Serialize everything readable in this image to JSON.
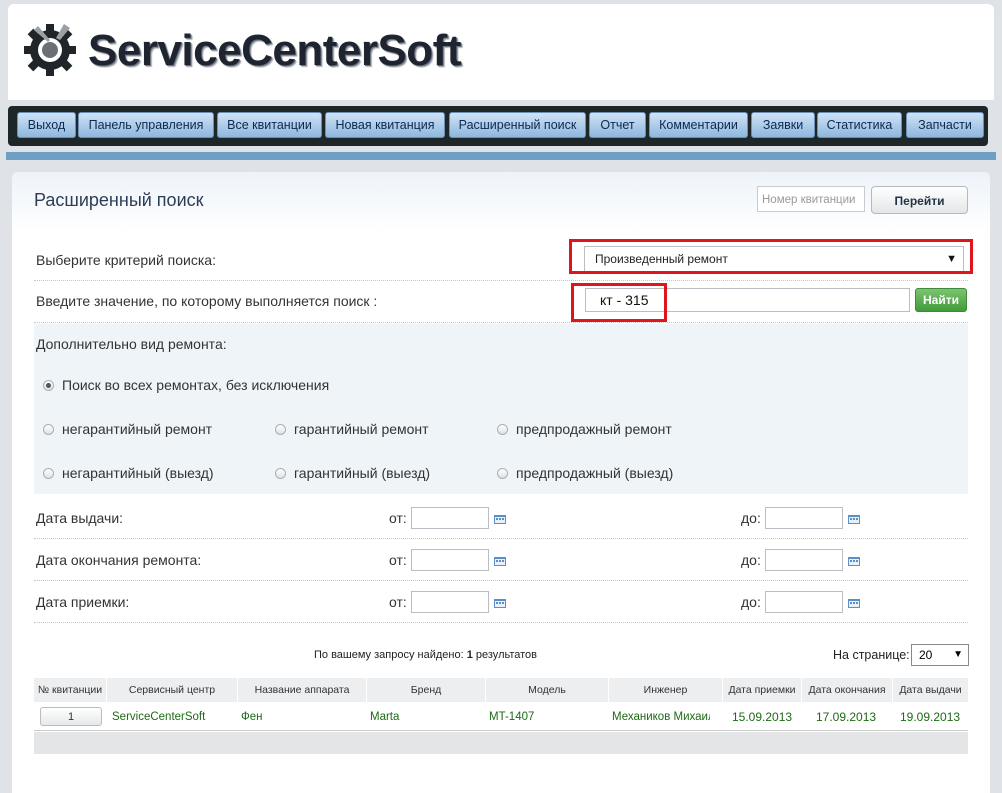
{
  "app": {
    "logo_text": "ServiceCenterSoft",
    "logo_icon": "gear-tools-icon"
  },
  "nav": {
    "items": [
      "Выход",
      "Панель управления",
      "Все квитанции",
      "Новая квитанция",
      "Расширенный поиск",
      "Отчет",
      "Комментарии",
      "Заявки",
      "Статистика",
      "Запчасти"
    ]
  },
  "page": {
    "title": "Расширенный поиск",
    "receipt_number_placeholder": "Номер квитанции",
    "go_button": "Перейти"
  },
  "search": {
    "criterion_label": "Выберите критерий поиска:",
    "criterion_value": "Произведенный ремонт",
    "value_label": "Введите значение, по которому выполняется поиск :",
    "value": "кт - 315",
    "find_button": "Найти"
  },
  "repair_type": {
    "label": "Дополнительно вид ремонта:",
    "options": [
      "Поиск во всех ремонтах, без исключения",
      "негарантийный ремонт",
      "гарантийный ремонт",
      "предпродажный ремонт",
      "негарантийный (выезд)",
      "гарантийный (выезд)",
      "предпродажный (выезд)"
    ],
    "selected_index": 0
  },
  "dates": {
    "from_label": "от:",
    "to_label": "до:",
    "rows": [
      "Дата выдачи:",
      "Дата окончания ремонта:",
      "Дата приемки:"
    ]
  },
  "results": {
    "found_prefix": "По вашему запросу найдено:",
    "found_count": "1",
    "found_suffix": "результатов",
    "per_page_label": "На странице:",
    "per_page_value": "20",
    "columns": [
      "№ квитанции",
      "Сервисный центр",
      "Название аппарата",
      "Бренд",
      "Модель",
      "Инженер",
      "Дата приемки",
      "Дата окончания",
      "Дата выдачи"
    ],
    "rows": [
      {
        "number": "1",
        "service_center": "ServiceCenterSoft",
        "device": "Фен",
        "brand": "Marta",
        "model": "MT-1407",
        "engineer": "Механиков Михаил",
        "received": "15.09.2013",
        "finished": "17.09.2013",
        "issued": "19.09.2013"
      }
    ]
  },
  "colors": {
    "highlight": "#e0141b",
    "nav_button": "#a9cbec",
    "find_button": "#4ea646",
    "table_text": "#1d6a15"
  }
}
